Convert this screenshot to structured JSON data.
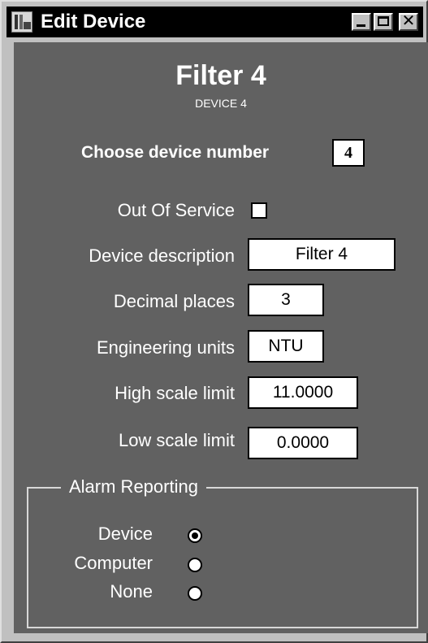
{
  "window": {
    "title": "Edit Device",
    "icon": "app-icon",
    "buttons": [
      "minimize-icon",
      "maximize-icon",
      "close-icon"
    ],
    "close_glyph": "✕"
  },
  "header": {
    "device_name": "Filter 4",
    "device_id": "DEVICE 4"
  },
  "device_number": {
    "label": "Choose device number",
    "value": "4"
  },
  "fields": {
    "out_of_service": {
      "label": "Out Of Service",
      "checked": false
    },
    "description": {
      "label": "Device description",
      "value": "Filter 4"
    },
    "decimal_places": {
      "label": "Decimal places",
      "value": "3"
    },
    "units": {
      "label": "Engineering units",
      "value": "NTU"
    },
    "high_limit": {
      "label": "High scale limit",
      "value": "11.0000"
    },
    "low_limit": {
      "label": "Low scale limit",
      "value": "0.0000"
    }
  },
  "alarm_reporting": {
    "title": "Alarm Reporting",
    "options": [
      {
        "label": "Device",
        "selected": true
      },
      {
        "label": "Computer",
        "selected": false
      },
      {
        "label": "None",
        "selected": false
      }
    ]
  },
  "colors": {
    "client_background": "#616161",
    "window_frame": "#c0c0c0",
    "title_bar": "#000000"
  }
}
